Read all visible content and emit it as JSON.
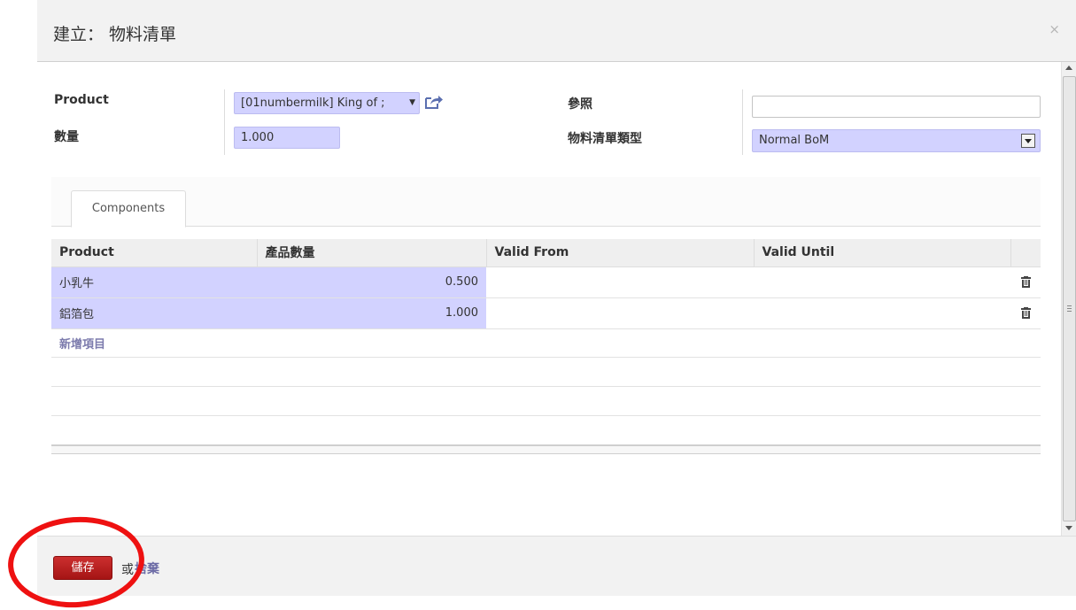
{
  "dialog": {
    "title": "建立： 物料清單",
    "close_label": "×"
  },
  "form": {
    "product_label": "Product",
    "product_value": "[01numbermilk] King of ;",
    "quantity_label": "數量",
    "quantity_value": "1.000",
    "reference_label": "參照",
    "reference_value": "",
    "bom_type_label": "物料清單類型",
    "bom_type_value": "Normal BoM"
  },
  "tabs": [
    {
      "label": "Components",
      "active": true
    }
  ],
  "components_table": {
    "columns": [
      "Product",
      "產品數量",
      "Valid From",
      "Valid Until"
    ],
    "rows": [
      {
        "product": "小乳牛",
        "quantity": "0.500",
        "valid_from": "",
        "valid_until": ""
      },
      {
        "product": "鋁箔包",
        "quantity": "1.000",
        "valid_from": "",
        "valid_until": ""
      }
    ],
    "add_item_label": "新增項目"
  },
  "footer": {
    "save_label": "儲存",
    "or_label": "或",
    "discard_label": "捨棄"
  },
  "colors": {
    "required_field": "#d2d2ff",
    "save_button": "#b21c1c",
    "link": "#7c7bad",
    "highlight": "#ee1111"
  }
}
